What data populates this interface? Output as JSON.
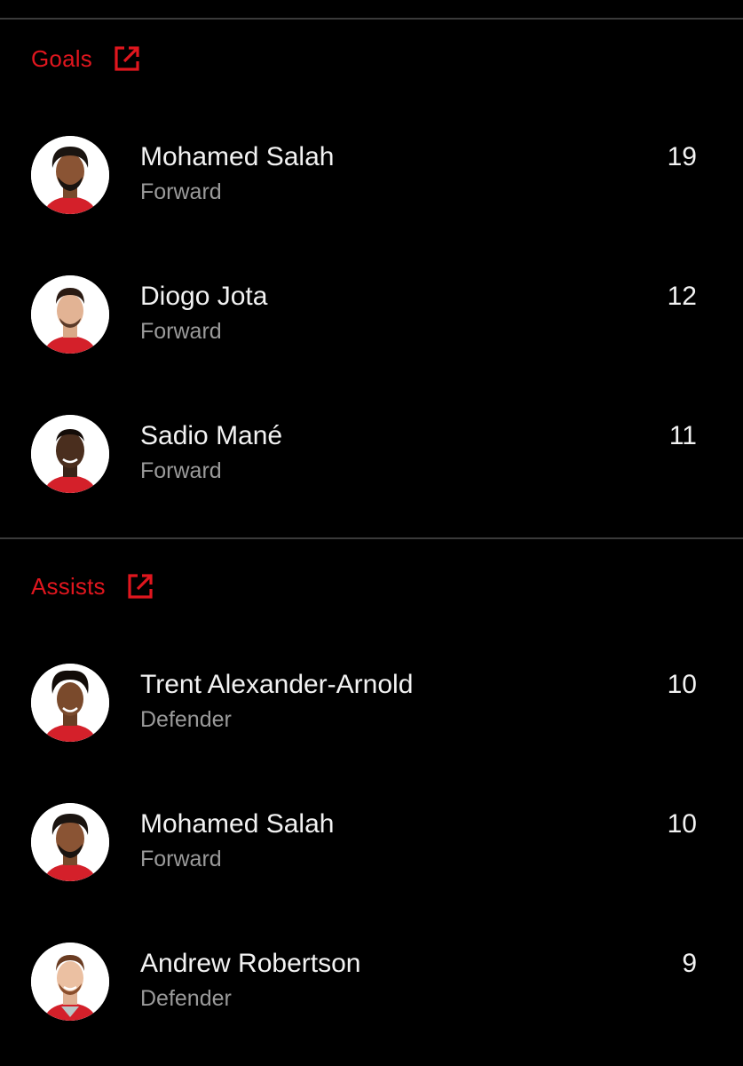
{
  "theme": {
    "accent": "#e0161e",
    "background": "#000000",
    "text_primary": "#f2f2f2",
    "text_secondary": "#9a9a9a"
  },
  "goals": {
    "title": "Goals",
    "icon": "external-link-icon",
    "players": [
      {
        "name": "Mohamed Salah",
        "position": "Forward",
        "value": "19"
      },
      {
        "name": "Diogo Jota",
        "position": "Forward",
        "value": "12"
      },
      {
        "name": "Sadio Mané",
        "position": "Forward",
        "value": "11"
      }
    ]
  },
  "assists": {
    "title": "Assists",
    "icon": "external-link-icon",
    "players": [
      {
        "name": "Trent Alexander-Arnold",
        "position": "Defender",
        "value": "10"
      },
      {
        "name": "Mohamed Salah",
        "position": "Forward",
        "value": "10"
      },
      {
        "name": "Andrew Robertson",
        "position": "Defender",
        "value": "9"
      }
    ]
  }
}
